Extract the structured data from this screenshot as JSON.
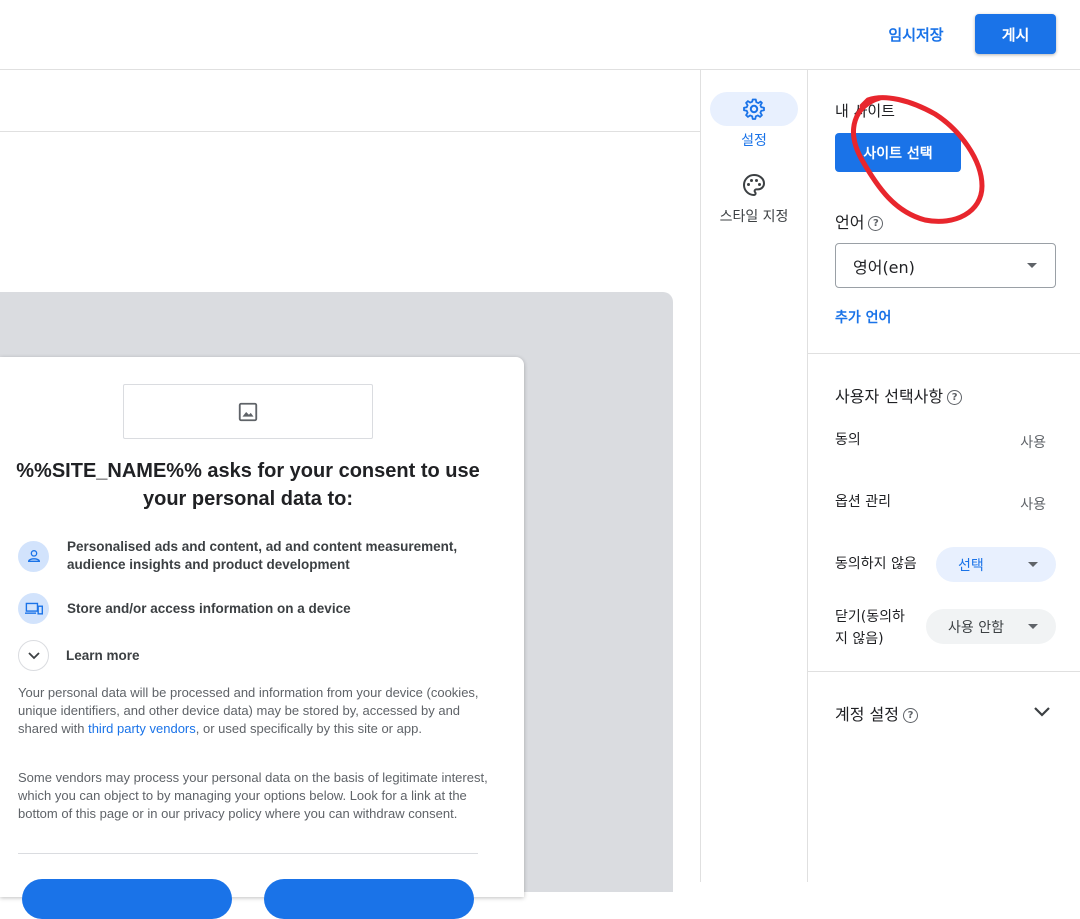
{
  "topbar": {
    "draft_label": "임시저장",
    "publish_label": "게시"
  },
  "preview": {
    "title": "%%SITE_NAME%% asks for your consent to use your personal data to:",
    "purposes": [
      {
        "icon": "person-icon",
        "text": "Personalised ads and content, ad and content measurement, audience insights and product development"
      },
      {
        "icon": "devices-icon",
        "text": "Store and/or access information on a device"
      }
    ],
    "learn_more": "Learn more",
    "para1_before": "Your personal data will be processed and information from your device (cookies, unique identifiers, and other device data) may be stored by, accessed by and shared with ",
    "para1_link": "third party vendors",
    "para1_after": ", or used specifically by this site or app.",
    "para2": "Some vendors may process your personal data on the basis of legitimate interest, which you can object to by managing your options below. Look for a link at the bottom of this page or in our privacy policy where you can withdraw consent."
  },
  "rail": {
    "items": [
      {
        "label": "설정",
        "icon": "gear-icon",
        "active": true
      },
      {
        "label": "스타일 지정",
        "icon": "palette-icon",
        "active": false
      }
    ]
  },
  "panel": {
    "my_sites_label": "내 사이트",
    "select_site_button": "사이트 선택",
    "language_label": "언어",
    "language_value": "영어(en)",
    "add_language_link": "추가 언어",
    "user_choices_title": "사용자 선택사항",
    "rows": [
      {
        "label": "동의",
        "value": "사용"
      },
      {
        "label": "옵션 관리",
        "value": "사용"
      }
    ],
    "do_not_consent_label": "동의하지 않음",
    "do_not_consent_value": "선택",
    "close_label_line1": "닫기(동의하",
    "close_label_line2": "지 않음)",
    "close_value": "사용 안함",
    "account_settings_title": "계정 설정"
  },
  "colors": {
    "accent": "#1a73e8",
    "annotation": "#e8262d"
  }
}
